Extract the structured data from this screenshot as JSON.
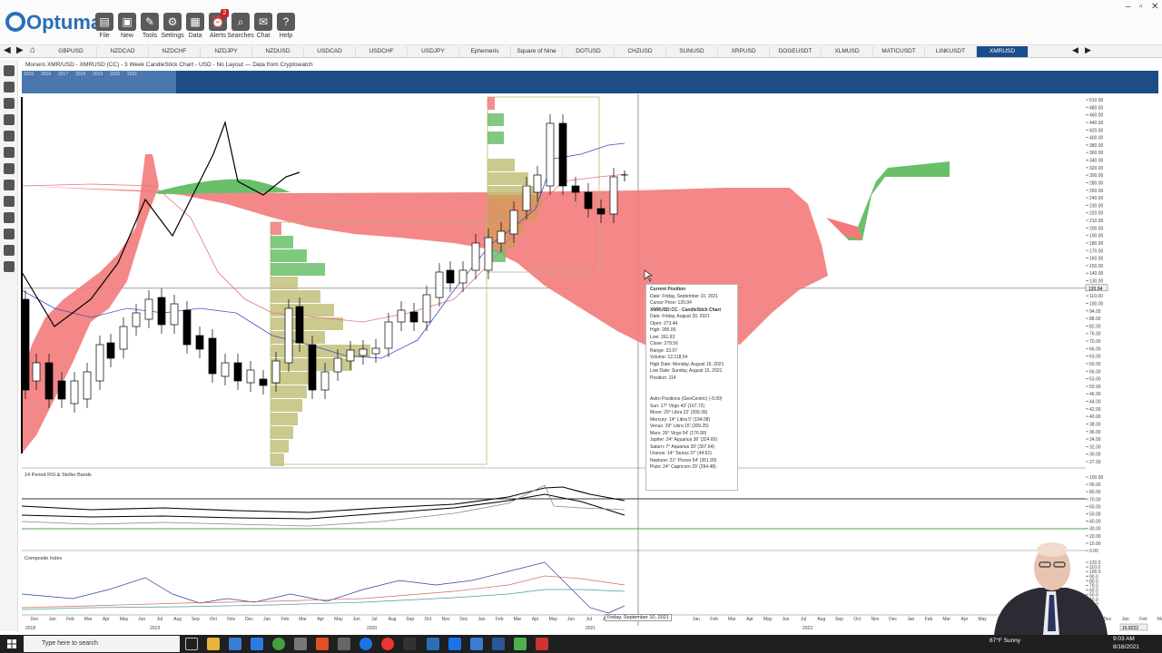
{
  "app": {
    "name": "Optuma"
  },
  "toolbar": {
    "buttons": [
      {
        "label": "File",
        "icon": "folder-icon"
      },
      {
        "label": "New",
        "icon": "new-icon"
      },
      {
        "label": "Tools",
        "icon": "tools-icon"
      },
      {
        "label": "Settings",
        "icon": "gear-icon"
      },
      {
        "label": "Data",
        "icon": "data-icon"
      },
      {
        "label": "Alerts",
        "icon": "alarm-icon",
        "badge": "2"
      },
      {
        "label": "Searches",
        "icon": "search-icon"
      },
      {
        "label": "Chat",
        "icon": "chat-icon"
      },
      {
        "label": "Help",
        "icon": "help-icon"
      }
    ]
  },
  "tabs": [
    "GBPUSD",
    "NZDCAD",
    "NZDCHF",
    "NZDJPY",
    "NZDUSD",
    "USDCAD",
    "USDCHF",
    "USDJPY",
    "Ephemeris",
    "Square of Nine",
    "DOTUSD",
    "CHZUSD",
    "SUNUSD",
    "XRPUSD",
    "DOGEUSDT",
    "XLMUSD",
    "MATICUSDT",
    "LINKUSDT",
    "XMRUSD"
  ],
  "active_tab": "XMRUSD",
  "chart_title": "Monero XMR/USD - XMRUSD (CC) - 3 Week CandleStick Chart - USD - No Layout — Data from Cryptowatch",
  "overview_years": [
    "2015",
    "2016",
    "2017",
    "2018",
    "2019",
    "2020",
    "2021"
  ],
  "price_axis": [
    "510.00",
    "480.00",
    "460.00",
    "440.00",
    "420.00",
    "400.00",
    "380.00",
    "360.00",
    "340.00",
    "320.00",
    "300.00",
    "280.00",
    "260.00",
    "240.00",
    "230.00",
    "220.00",
    "210.00",
    "200.00",
    "190.00",
    "180.00",
    "170.00",
    "160.00",
    "150.00",
    "140.00",
    "130.00",
    "120.94",
    "110.00",
    "100.00",
    "94.00",
    "88.00",
    "82.00",
    "76.00",
    "70.00",
    "66.00",
    "63.00",
    "60.00",
    "56.00",
    "53.00",
    "50.00",
    "46.00",
    "44.00",
    "42.00",
    "40.00",
    "38.00",
    "36.00",
    "34.00",
    "32.00",
    "30.00",
    "27.00"
  ],
  "current_price": "120.94",
  "rsi_panel": {
    "title": "14 Period RSI & Stoller Bands",
    "axis": [
      "100.00",
      "90.00",
      "80.00",
      "70.00",
      "60.00",
      "50.00",
      "40.00",
      "30.00",
      "20.00",
      "10.00",
      "0.00"
    ]
  },
  "composite_panel": {
    "title": "Composite Index",
    "axis": [
      "120.0",
      "110.0",
      "100.0",
      "90.0",
      "80.0",
      "70.0",
      "60.0",
      "50.0",
      "40.0",
      "30.0",
      "20.0",
      "10.0",
      "0.0"
    ],
    "last_value": "16.8222"
  },
  "x_axis": {
    "months": [
      "Dec",
      "Jan",
      "Feb",
      "Mar",
      "Apr",
      "May",
      "Jun",
      "Jul",
      "Aug",
      "Sep",
      "Oct",
      "Nov",
      "Dec",
      "Jan",
      "Feb",
      "Mar",
      "Apr",
      "May",
      "Jun",
      "Jul",
      "Aug",
      "Sep",
      "Oct",
      "Nov",
      "Dec",
      "Jan",
      "Feb",
      "Mar",
      "Apr",
      "May",
      "Jun",
      "Jul",
      "Aug",
      "Sep",
      "Oct",
      "Nov",
      "Dec",
      "Jan",
      "Feb",
      "Mar",
      "Apr",
      "May",
      "Jun",
      "Jul",
      "Aug",
      "Sep",
      "Oct",
      "Nov",
      "Dec",
      "Jan",
      "Feb",
      "Mar",
      "Apr",
      "May",
      "Jun",
      "Jul",
      "Aug",
      "Sep",
      "Oct",
      "Nov",
      "Dec",
      "Jan",
      "Feb",
      "Mar",
      "Apr"
    ],
    "years": [
      "2018",
      "2019",
      "2020",
      "2021",
      "2022"
    ],
    "cursor_date": "Friday, September 10, 2021"
  },
  "tooltip": {
    "title": "Current Position",
    "date": "Date: Friday, September 10, 2021",
    "cursor_price": "Cursor Price: 120.94",
    "series_title": "XMRUSD:CC - CandleStick Chart",
    "lines": [
      "Date: Friday, August 20, 2021",
      "Open: 273.44",
      "High: 285.00",
      "Low: 261.93",
      "Close: 279.56",
      "Range: 23.07",
      "Volume: 12,118.54",
      "High Date: Monday, August 16, 2021",
      "Low Date: Sunday, August 15, 2021",
      "Position: 114"
    ],
    "astro_title": "Astro Positions (GeoCentric) (-5:00)",
    "astro": [
      "Sun: 17° Virgo 43' (167.72)",
      "Moon: 29° Libra 22' (209.36)",
      "Mercury: 14° Libra 5' (194.08)",
      "Venus: 29° Libra 15' (209.25)",
      "Mars: 26° Virgo 54' (176.90)",
      "Jupiter: 24° Aquarius 36' (324.60)",
      "Saturn: 7° Aquarius 39' (307.64)",
      "Uranus: 14° Taurus 37' (44.61)",
      "Neptune: 21° Pisces 54' (351.90)",
      "Pluto: 24° Capricorn 29' (294.48)"
    ]
  },
  "taskbar": {
    "search_placeholder": "Type here to search",
    "weather": "67°F Sunny",
    "time": "9:03 AM",
    "date": "8/16/2021"
  }
}
